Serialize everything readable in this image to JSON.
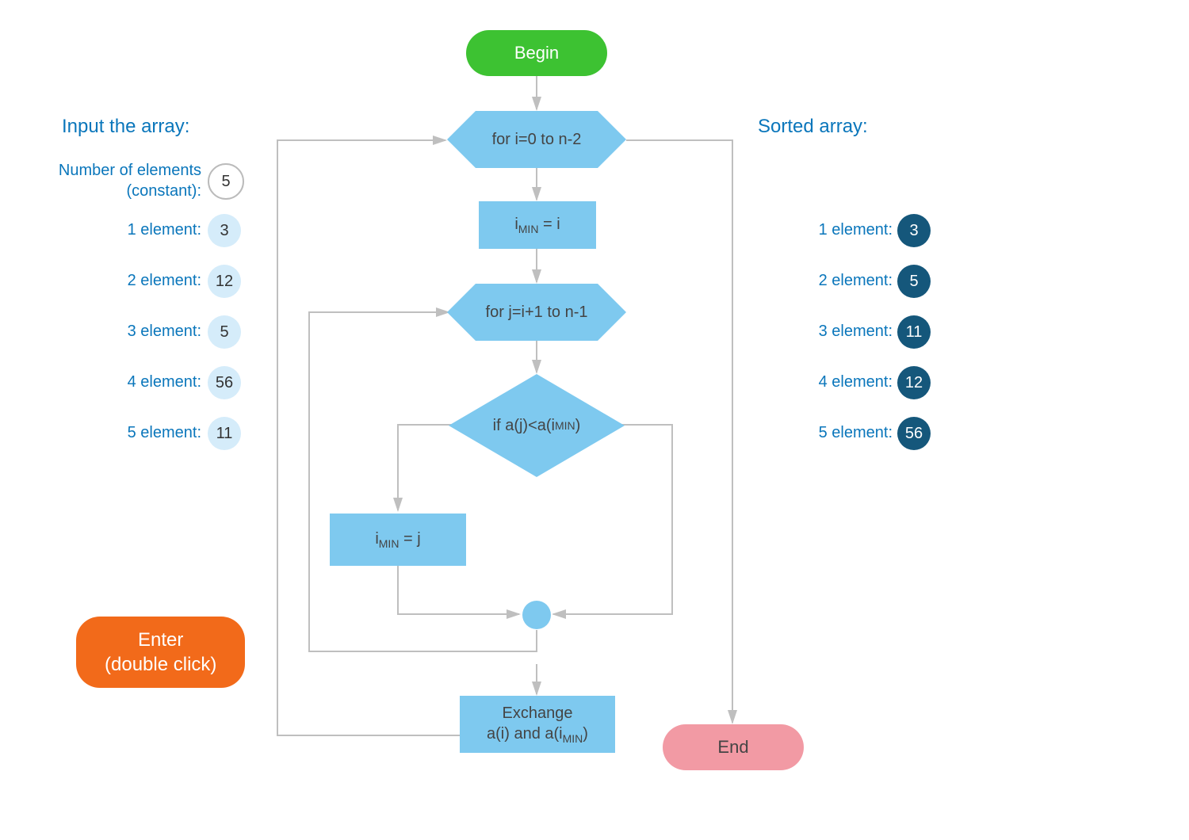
{
  "left_panel": {
    "title": "Input the array:",
    "n_label": "Number of elements\n(constant):",
    "n_value": "5",
    "elements": [
      {
        "label": "1 element:",
        "value": "3"
      },
      {
        "label": "2 element:",
        "value": "12"
      },
      {
        "label": "3 element:",
        "value": "5"
      },
      {
        "label": "4 element:",
        "value": "56"
      },
      {
        "label": "5 element:",
        "value": "11"
      }
    ],
    "button": "Enter\n(double click)"
  },
  "right_panel": {
    "title": "Sorted array:",
    "elements": [
      {
        "label": "1 element:",
        "value": "3"
      },
      {
        "label": "2 element:",
        "value": "5"
      },
      {
        "label": "3 element:",
        "value": "11"
      },
      {
        "label": "4 element:",
        "value": "12"
      },
      {
        "label": "5 element:",
        "value": "56"
      }
    ]
  },
  "flowchart": {
    "begin": "Begin",
    "for_i": "for i=0 to n-2",
    "imin_eq_i": "iMIN = i",
    "for_j": "for j=i+1 to n-1",
    "if_cond": "if a(j)<a(iMIN)",
    "imin_eq_j": "iMIN = j",
    "exchange": "Exchange\na(i) and a(iMIN)",
    "end": "End"
  }
}
